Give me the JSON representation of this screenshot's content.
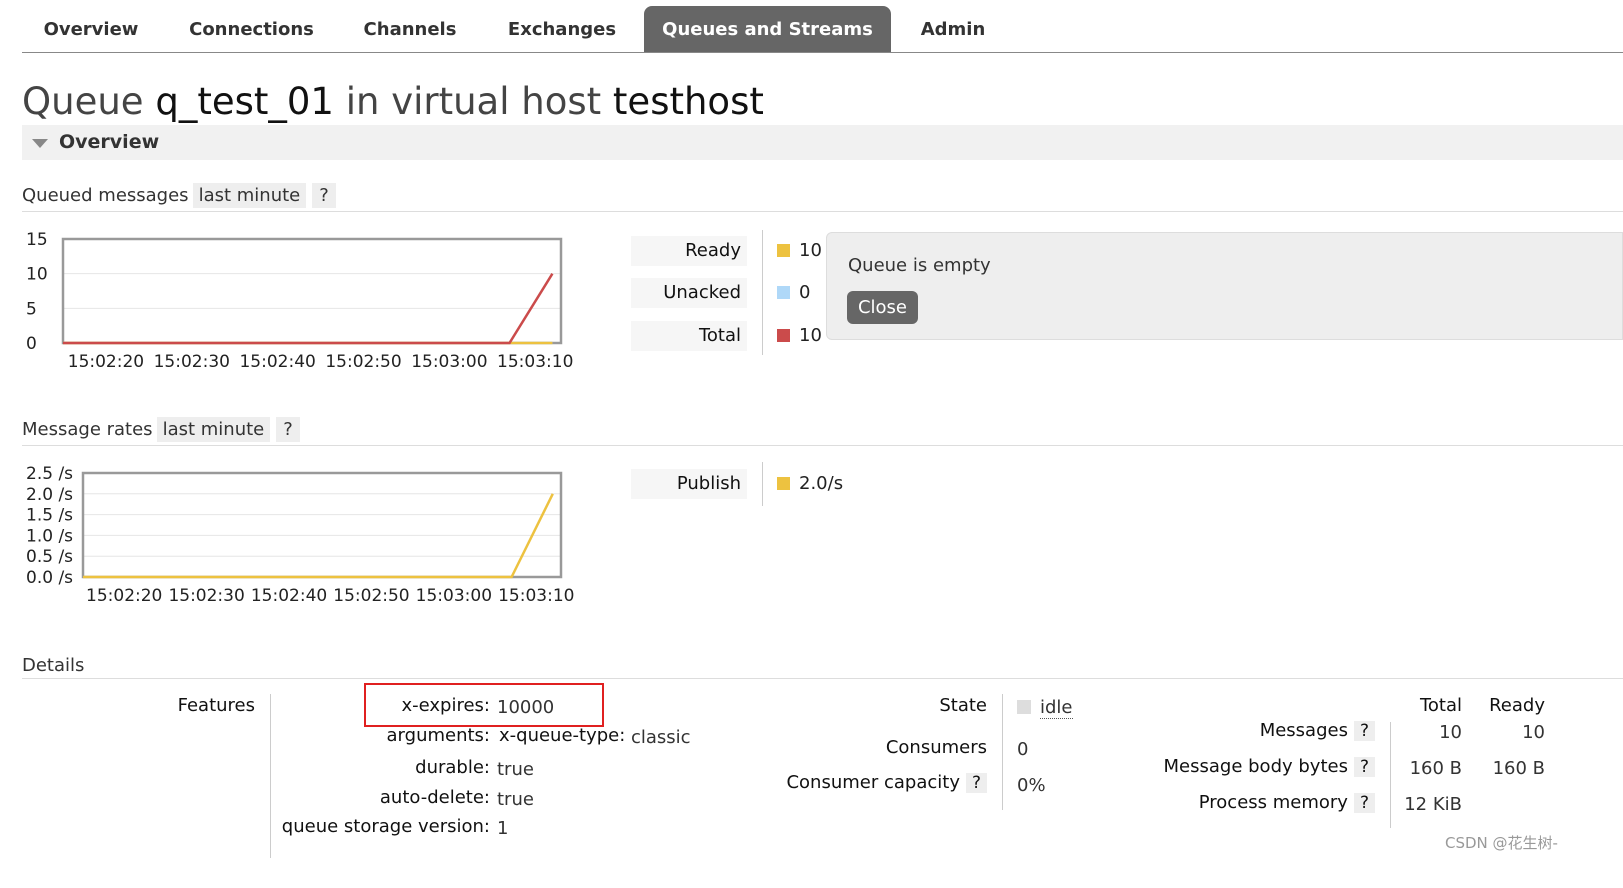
{
  "tabs": [
    {
      "label": "Overview",
      "active": false
    },
    {
      "label": "Connections",
      "active": false
    },
    {
      "label": "Channels",
      "active": false
    },
    {
      "label": "Exchanges",
      "active": false
    },
    {
      "label": "Queues and Streams",
      "active": true
    },
    {
      "label": "Admin",
      "active": false
    }
  ],
  "title": {
    "prefix": "Queue",
    "queue_name": "q_test_01",
    "middle": "in virtual host",
    "vhost": "testhost"
  },
  "overview_section": {
    "label": "Overview"
  },
  "queued_messages": {
    "label": "Queued messages",
    "range": "last minute",
    "help": "?",
    "legend": [
      {
        "label": "Ready",
        "value": "10",
        "color": "#edc240"
      },
      {
        "label": "Unacked",
        "value": "0",
        "color": "#afd8f8"
      },
      {
        "label": "Total",
        "value": "10",
        "color": "#cb4b4b"
      }
    ]
  },
  "message_rates": {
    "label": "Message rates",
    "range": "last minute",
    "help": "?",
    "legend": [
      {
        "label": "Publish",
        "value": "2.0/s",
        "color": "#edc240"
      }
    ]
  },
  "popup": {
    "message": "Queue is empty",
    "close_label": "Close"
  },
  "details": {
    "label": "Details",
    "features_label": "Features",
    "features": [
      {
        "key": "x-expires:",
        "value": "10000"
      },
      {
        "key": "arguments:",
        "sub_key": "x-queue-type:",
        "value": "classic"
      },
      {
        "key": "durable:",
        "value": "true"
      },
      {
        "key": "auto-delete:",
        "value": "true"
      },
      {
        "key": "queue storage version:",
        "value": "1"
      }
    ],
    "state_label": "State",
    "state_value": "idle",
    "consumers_label": "Consumers",
    "consumers_value": "0",
    "consumer_capacity_label": "Consumer capacity",
    "consumer_capacity_help": "?",
    "consumer_capacity_value": "0%",
    "stats_headers": [
      "Total",
      "Ready"
    ],
    "stats": [
      {
        "label": "Messages",
        "help": "?",
        "total": "10",
        "ready": "10"
      },
      {
        "label": "Message body bytes",
        "help": "?",
        "total": "160 B",
        "ready": "160 B"
      },
      {
        "label": "Process memory",
        "help": "?",
        "total": "12 KiB",
        "ready": ""
      }
    ]
  },
  "watermark": "CSDN @花生树-",
  "chart_data": [
    {
      "type": "line",
      "title": "Queued messages",
      "x": [
        "15:02:20",
        "15:02:30",
        "15:02:40",
        "15:02:50",
        "15:03:00",
        "15:03:10"
      ],
      "ylim": [
        0,
        15
      ],
      "yticks": [
        "15",
        "10",
        "5",
        "0"
      ],
      "series": [
        {
          "name": "Total",
          "color": "#cb4b4b",
          "points": [
            [
              "15:02:15",
              0
            ],
            [
              "15:03:07",
              0
            ],
            [
              "15:03:12",
              10
            ]
          ]
        },
        {
          "name": "Ready",
          "color": "#edc240",
          "points": [
            [
              "15:02:15",
              0
            ],
            [
              "15:03:07",
              0
            ],
            [
              "15:03:12",
              0
            ]
          ]
        },
        {
          "name": "Unacked",
          "color": "#afd8f8",
          "points": [
            [
              "15:02:15",
              0
            ],
            [
              "15:03:12",
              0
            ]
          ]
        }
      ]
    },
    {
      "type": "line",
      "title": "Message rates",
      "x": [
        "15:02:20",
        "15:02:30",
        "15:02:40",
        "15:02:50",
        "15:03:00",
        "15:03:10"
      ],
      "ylim": [
        0,
        2.5
      ],
      "yticks": [
        "2.5 /s",
        "2.0 /s",
        "1.5 /s",
        "1.0 /s",
        "0.5 /s",
        "0.0 /s"
      ],
      "series": [
        {
          "name": "Publish",
          "color": "#edc240",
          "points": [
            [
              "15:02:15",
              0
            ],
            [
              "15:03:07",
              0
            ],
            [
              "15:03:12",
              2
            ]
          ]
        }
      ]
    }
  ]
}
